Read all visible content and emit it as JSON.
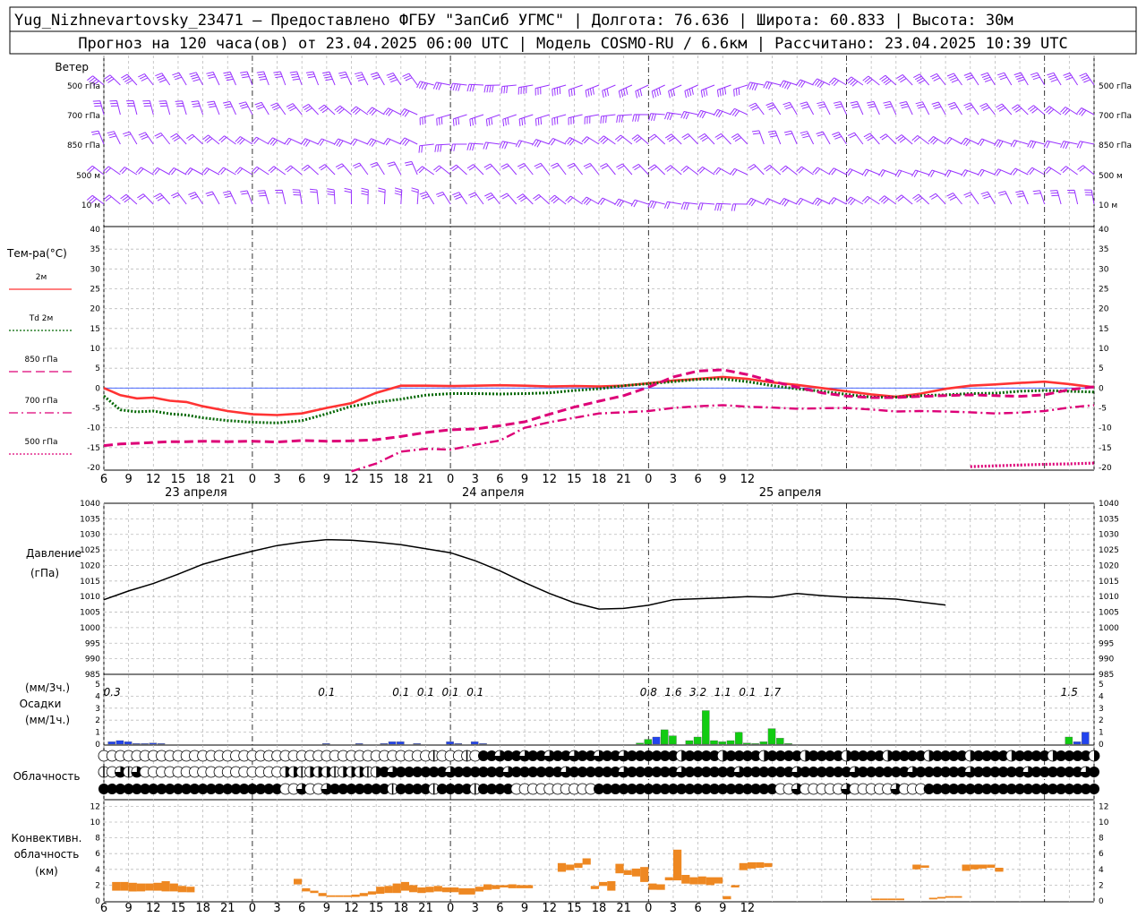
{
  "header": {
    "line1": "Yug_Nizhnevartovsky_23471 – Предоставлено ФГБУ \"ЗапСиб УГМС\" | Долгота: 76.636 | Широта: 60.833 | Высота: 30м",
    "line2": "Прогноз на 120 часа(ов) от 23.04.2025 06:00 UTC  | Модель COSMO-RU / 6.6км | Рассчитано: 23.04.2025 10:39 UTC"
  },
  "x_axis": {
    "hour_labels": [
      "6",
      "9",
      "12",
      "15",
      "18",
      "21",
      "0",
      "3",
      "6",
      "9",
      "12",
      "15",
      "18",
      "21",
      "0",
      "3",
      "6",
      "9",
      "12",
      "15",
      "18",
      "21",
      "0",
      "3",
      "6",
      "9",
      "12"
    ],
    "date_labels": [
      "23 апреля",
      "24 апреля",
      "25 апреля"
    ]
  },
  "wind_panel": {
    "title": "Ветер",
    "levels": [
      "500 гПа",
      "700 гПа",
      "850 гПа",
      "500 м",
      "10   м"
    ],
    "color": "#9933ff"
  },
  "temp_panel": {
    "title": "Тем-ра(°C)",
    "legend": [
      {
        "label": "2м",
        "color": "#ff3333",
        "style": "solid"
      },
      {
        "label": "Td  2м",
        "color": "#006600",
        "style": "dotted"
      },
      {
        "label": "850 гПа",
        "color": "#dd0077",
        "style": "dashed"
      },
      {
        "label": "700 гПа",
        "color": "#dd0077",
        "style": "dashdot"
      },
      {
        "label": "500 гПа",
        "color": "#dd0077",
        "style": "dotted"
      }
    ],
    "ticks": [
      "40",
      "35",
      "30",
      "25",
      "20",
      "15",
      "10",
      "5",
      "0",
      "-5",
      "-10",
      "-15",
      "-20"
    ]
  },
  "pressure_panel": {
    "title": "Давление",
    "unit": "(гПа)",
    "ticks": [
      "1040",
      "1035",
      "1030",
      "1025",
      "1020",
      "1015",
      "1010",
      "1005",
      "1000",
      "995",
      "990",
      "985"
    ]
  },
  "precip_panel": {
    "unit3h": "(мм/3ч.)",
    "title": "Осадки",
    "unit1h": "(мм/1ч.)",
    "ticks": [
      "5",
      "4",
      "3",
      "2",
      "1",
      "0"
    ],
    "totals": [
      {
        "h": 1,
        "v": "0.3"
      },
      {
        "h": 27,
        "v": "0.1"
      },
      {
        "h": 36,
        "v": "0.1"
      },
      {
        "h": 39,
        "v": "0.1"
      },
      {
        "h": 42,
        "v": "0.1"
      },
      {
        "h": 45,
        "v": "0.1"
      },
      {
        "h": 66,
        "v": "0.8"
      },
      {
        "h": 69,
        "v": "1.6"
      },
      {
        "h": 72,
        "v": "3.2"
      },
      {
        "h": 75,
        "v": "1.1"
      },
      {
        "h": 78,
        "v": "0.1"
      },
      {
        "h": 81,
        "v": "1.7"
      },
      {
        "h": 117,
        "v": "1.5"
      }
    ]
  },
  "cloud_panel": {
    "title": "Облачность"
  },
  "conv_panel": {
    "title1": "Конвективн.",
    "title2": "облачность",
    "unit": "(км)",
    "ticks": [
      "12",
      "10",
      "8",
      "6",
      "4",
      "2",
      "0"
    ],
    "color": "#ee8822"
  },
  "chart_data": [
    {
      "type": "line",
      "title": "Тем-ра(°C)",
      "x_hours": [
        0,
        2,
        4,
        6,
        8,
        10,
        12,
        15,
        18,
        21,
        24,
        27,
        30,
        33,
        36,
        39,
        42,
        45,
        48,
        51,
        54,
        57,
        60,
        63,
        66,
        69,
        72,
        75,
        78,
        81,
        84,
        87,
        90,
        93,
        96,
        99,
        102,
        105,
        108,
        111,
        114,
        117,
        120
      ],
      "ylim": [
        -20,
        40
      ],
      "series": [
        {
          "name": "2м",
          "values": [
            0,
            -1.8,
            -2.6,
            -2.4,
            -3.2,
            -3.5,
            -4.6,
            -5.8,
            -6.6,
            -6.8,
            -6.4,
            -5,
            -3.8,
            -1.2,
            0.6,
            0.6,
            0.5,
            0.6,
            0.7,
            0.6,
            0.4,
            0.5,
            0.4,
            0.6,
            1.2,
            1.9,
            2.3,
            2.8,
            2.3,
            1.4,
            0.8,
            0,
            -0.8,
            -1.6,
            -2.2,
            -1.4,
            -0.2,
            0.6,
            0.9,
            1.3,
            1.6,
            1,
            0.2
          ]
        },
        {
          "name": "Td  2м",
          "values": [
            -2,
            -5.5,
            -6,
            -5.8,
            -6.5,
            -6.8,
            -7.5,
            -8.2,
            -8.6,
            -8.8,
            -8.2,
            -6.5,
            -4.6,
            -3.6,
            -2.8,
            -1.8,
            -1.4,
            -1.4,
            -1.5,
            -1.4,
            -1.2,
            -0.6,
            -0.2,
            0.6,
            1.1,
            1.6,
            2.2,
            2.3,
            1.6,
            0.6,
            -0.2,
            -0.8,
            -1.6,
            -2.3,
            -2.3,
            -1.9,
            -1.7,
            -1.4,
            -1.3,
            -0.8,
            -0.6,
            -0.8,
            -1
          ]
        },
        {
          "name": "850 гПа",
          "values": [
            -14.5,
            -14.1,
            -13.9,
            -13.7,
            -13.5,
            -13.5,
            -13.4,
            -13.5,
            -13.4,
            -13.6,
            -13.2,
            -13.4,
            -13.3,
            -13,
            -12.2,
            -11.2,
            -10.5,
            -10.3,
            -9.5,
            -8.5,
            -6.6,
            -4.8,
            -3.3,
            -1.9,
            0.2,
            2.8,
            4.3,
            4.6,
            3.4,
            1.7,
            0.2,
            -1.2,
            -2,
            -2.4,
            -2.4,
            -2.1,
            -1.9,
            -1.7,
            -1.9,
            -2.1,
            -1.7,
            -0.4,
            0.3
          ]
        },
        {
          "name": "700 гПа",
          "values": [
            null,
            null,
            null,
            null,
            null,
            null,
            null,
            null,
            null,
            null,
            null,
            null,
            -21,
            -19,
            -16,
            -15.3,
            -15.5,
            -14.3,
            -13.2,
            -10,
            -8.6,
            -7.5,
            -6.4,
            -6.1,
            -5.8,
            -5,
            -4.6,
            -4.3,
            -4.7,
            -4.9,
            -5.2,
            -5.1,
            -5,
            -5.4,
            -5.9,
            -5.8,
            -5.9,
            -6.1,
            -6.4,
            -6.2,
            -5.8,
            -4.9,
            -4.3
          ]
        },
        {
          "name": "500 гПа",
          "values": [
            null,
            null,
            null,
            null,
            null,
            null,
            null,
            null,
            null,
            null,
            null,
            null,
            null,
            null,
            null,
            null,
            null,
            null,
            null,
            null,
            null,
            null,
            null,
            null,
            null,
            null,
            null,
            null,
            null,
            null,
            null,
            null,
            null,
            null,
            null,
            null,
            null,
            -19.8,
            -19.6,
            -19.4,
            -19.2,
            -19.1,
            -18.9
          ]
        }
      ]
    },
    {
      "type": "line",
      "title": "Давление",
      "ylabel": "(гПа)",
      "x_hours": [
        0,
        3,
        6,
        9,
        12,
        15,
        18,
        21,
        24,
        27,
        30,
        33,
        36,
        39,
        42,
        45,
        48,
        51,
        54,
        57,
        60,
        63,
        66,
        69,
        72,
        75,
        78,
        81,
        84,
        87,
        90,
        93,
        96,
        99,
        102,
        105,
        108,
        111,
        114,
        117,
        120
      ],
      "ylim": [
        985,
        1040
      ],
      "values": [
        1009,
        1011.8,
        1014.2,
        1017.2,
        1020.4,
        1022.6,
        1024.6,
        1026.4,
        1027.5,
        1028.3,
        1028.1,
        1027.5,
        1026.7,
        1025.4,
        1024.1,
        1021.5,
        1018.3,
        1014.5,
        1011,
        1008,
        1006,
        1006.2,
        1007.2,
        1009,
        1009.3,
        1009.6,
        1010,
        1009.8,
        1011,
        1010.3,
        1009.8,
        1009.5,
        1009.2,
        1008.2,
        1007.3
      ]
    },
    {
      "type": "bar",
      "title": "Осадки",
      "ylabel": "(мм/1ч.)",
      "ylim": [
        0,
        5
      ],
      "series": [
        {
          "name": "blue",
          "hours": [
            1,
            2,
            3,
            4,
            5,
            6,
            7,
            27,
            31,
            34,
            35,
            36,
            38,
            42,
            43,
            45,
            46,
            66,
            67,
            68,
            118,
            119
          ],
          "values": [
            0.2,
            0.3,
            0.2,
            0.05,
            0.05,
            0.1,
            0.05,
            0.05,
            0.05,
            0.05,
            0.2,
            0.2,
            0.05,
            0.2,
            0.05,
            0.2,
            0.05,
            0.2,
            0.6,
            1,
            0.2,
            1
          ]
        },
        {
          "name": "green",
          "hours": [
            65,
            66,
            68,
            69,
            71,
            72,
            73,
            74,
            75,
            76,
            77,
            78,
            79,
            80,
            81,
            82,
            83,
            117
          ],
          "values": [
            0.1,
            0.4,
            1.2,
            0.7,
            0.3,
            0.6,
            2.8,
            0.3,
            0.2,
            0.3,
            1,
            0.1,
            0.05,
            0.2,
            1.3,
            0.5,
            0.05,
            0.6
          ]
        }
      ]
    },
    {
      "type": "bar",
      "title": "Конвективн. облачность",
      "ylabel": "(км)",
      "ylim": [
        0,
        13
      ],
      "segments": [
        [
          1,
          2,
          1.3,
          2.4
        ],
        [
          2,
          3,
          1.3,
          2.4
        ],
        [
          3,
          4,
          1.2,
          2.3
        ],
        [
          4,
          5,
          1.2,
          2.2
        ],
        [
          5,
          6,
          1.3,
          2.2
        ],
        [
          6,
          7,
          1.3,
          2.3
        ],
        [
          7,
          8,
          1.2,
          2.5
        ],
        [
          8,
          9,
          1.2,
          2.2
        ],
        [
          9,
          10,
          1.1,
          1.9
        ],
        [
          10,
          11,
          1.1,
          1.8
        ],
        [
          23,
          24,
          2.1,
          2.8
        ],
        [
          24,
          25,
          1.2,
          1.6
        ],
        [
          25,
          26,
          1.0,
          1.3
        ],
        [
          26,
          27,
          0.6,
          1.0
        ],
        [
          27,
          28,
          0.5,
          0.7
        ],
        [
          28,
          29,
          0.5,
          0.7
        ],
        [
          29,
          30,
          0.5,
          0.7
        ],
        [
          30,
          31,
          0.5,
          0.8
        ],
        [
          31,
          32,
          0.6,
          1.0
        ],
        [
          32,
          33,
          0.8,
          1.2
        ],
        [
          33,
          34,
          0.9,
          1.8
        ],
        [
          34,
          35,
          1.0,
          1.9
        ],
        [
          35,
          36,
          1.0,
          2.2
        ],
        [
          36,
          37,
          1.3,
          2.4
        ],
        [
          37,
          38,
          1.1,
          2.0
        ],
        [
          38,
          39,
          1.0,
          1.7
        ],
        [
          39,
          40,
          1.1,
          1.8
        ],
        [
          40,
          41,
          1.2,
          1.9
        ],
        [
          41,
          42,
          1.1,
          1.7
        ],
        [
          42,
          43,
          1.1,
          1.7
        ],
        [
          43,
          44,
          0.8,
          1.6
        ],
        [
          44,
          45,
          0.8,
          1.6
        ],
        [
          45,
          46,
          1.2,
          1.8
        ],
        [
          46,
          47,
          1.4,
          2.1
        ],
        [
          47,
          48,
          1.5,
          2.0
        ],
        [
          48,
          49,
          1.7,
          2.0
        ],
        [
          49,
          50,
          1.6,
          2.1
        ],
        [
          50,
          51,
          1.6,
          2.0
        ],
        [
          51,
          52,
          1.6,
          2.0
        ],
        [
          55,
          56,
          3.7,
          4.8
        ],
        [
          56,
          57,
          3.9,
          4.6
        ],
        [
          57,
          58,
          4.2,
          4.8
        ],
        [
          58,
          59,
          4.6,
          5.4
        ],
        [
          59,
          60,
          1.5,
          1.9
        ],
        [
          60,
          61,
          1.9,
          2.4
        ],
        [
          61,
          62,
          1.3,
          2.5
        ],
        [
          62,
          63,
          3.5,
          4.7
        ],
        [
          63,
          64,
          3.3,
          3.9
        ],
        [
          64,
          65,
          3.1,
          4.1
        ],
        [
          65,
          66,
          2.4,
          4.3
        ],
        [
          66,
          67,
          1.4,
          2.2
        ],
        [
          67,
          68,
          1.4,
          2.1
        ],
        [
          68,
          69,
          2.6,
          3.0
        ],
        [
          69,
          70,
          2.6,
          6.5
        ],
        [
          70,
          71,
          2.2,
          3.3
        ],
        [
          71,
          72,
          2.1,
          3.0
        ],
        [
          72,
          73,
          2.1,
          3.1
        ],
        [
          73,
          74,
          2.0,
          3.0
        ],
        [
          74,
          75,
          2.2,
          3.0
        ],
        [
          75,
          76,
          0.2,
          0.6
        ],
        [
          76,
          77,
          1.7,
          2.0
        ],
        [
          77,
          78,
          3.9,
          4.8
        ],
        [
          78,
          79,
          4.1,
          4.9
        ],
        [
          79,
          80,
          4.2,
          4.9
        ],
        [
          80,
          81,
          4.3,
          4.8
        ],
        [
          93,
          94,
          0.1,
          0.3
        ],
        [
          94,
          95,
          0.1,
          0.3
        ],
        [
          95,
          96,
          0.1,
          0.3
        ],
        [
          96,
          97,
          0.1,
          0.3
        ],
        [
          98,
          99,
          4.0,
          4.6
        ],
        [
          99,
          100,
          4.2,
          4.5
        ],
        [
          100,
          101,
          0.2,
          0.4
        ],
        [
          101,
          102,
          0.3,
          0.5
        ],
        [
          102,
          103,
          0.4,
          0.6
        ],
        [
          103,
          104,
          0.4,
          0.6
        ],
        [
          104,
          105,
          3.8,
          4.6
        ],
        [
          105,
          106,
          4.0,
          4.6
        ],
        [
          106,
          107,
          4.1,
          4.6
        ],
        [
          107,
          108,
          4.2,
          4.6
        ],
        [
          108,
          109,
          3.7,
          4.2
        ]
      ]
    }
  ]
}
